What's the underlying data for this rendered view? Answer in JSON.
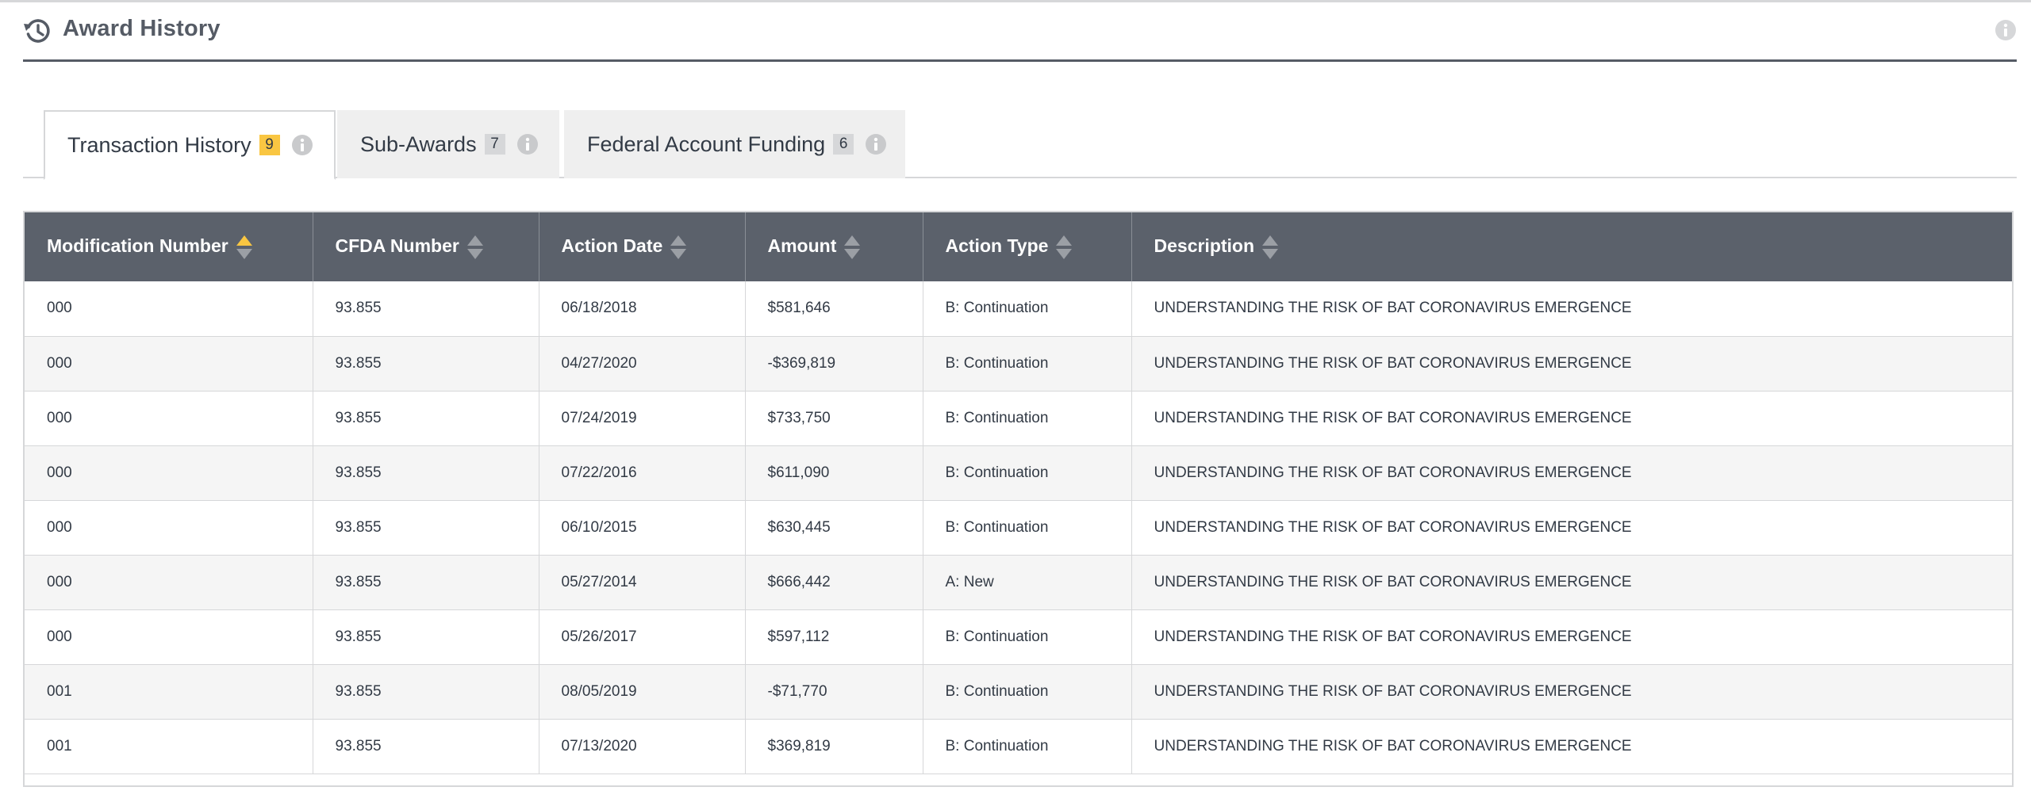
{
  "header": {
    "title": "Award History",
    "icon": "history-icon",
    "info_icon": "info-icon"
  },
  "tabs": [
    {
      "label": "Transaction History",
      "count": "9",
      "active": true
    },
    {
      "label": "Sub-Awards",
      "count": "7",
      "active": false
    },
    {
      "label": "Federal Account Funding",
      "count": "6",
      "active": false
    }
  ],
  "colors": {
    "header_bg": "#5b616b",
    "accent": "#f9c642",
    "title": "#555b65"
  },
  "table": {
    "sort": {
      "column": "Modification Number",
      "direction": "ascending"
    },
    "columns": [
      "Modification Number",
      "CFDA Number",
      "Action Date",
      "Amount",
      "Action Type",
      "Description"
    ],
    "rows": [
      [
        "000",
        "93.855",
        "06/18/2018",
        "$581,646",
        "B: Continuation",
        "UNDERSTANDING THE RISK OF BAT CORONAVIRUS EMERGENCE"
      ],
      [
        "000",
        "93.855",
        "04/27/2020",
        "-$369,819",
        "B: Continuation",
        "UNDERSTANDING THE RISK OF BAT CORONAVIRUS EMERGENCE"
      ],
      [
        "000",
        "93.855",
        "07/24/2019",
        "$733,750",
        "B: Continuation",
        "UNDERSTANDING THE RISK OF BAT CORONAVIRUS EMERGENCE"
      ],
      [
        "000",
        "93.855",
        "07/22/2016",
        "$611,090",
        "B: Continuation",
        "UNDERSTANDING THE RISK OF BAT CORONAVIRUS EMERGENCE"
      ],
      [
        "000",
        "93.855",
        "06/10/2015",
        "$630,445",
        "B: Continuation",
        "UNDERSTANDING THE RISK OF BAT CORONAVIRUS EMERGENCE"
      ],
      [
        "000",
        "93.855",
        "05/27/2014",
        "$666,442",
        "A: New",
        "UNDERSTANDING THE RISK OF BAT CORONAVIRUS EMERGENCE"
      ],
      [
        "000",
        "93.855",
        "05/26/2017",
        "$597,112",
        "B: Continuation",
        "UNDERSTANDING THE RISK OF BAT CORONAVIRUS EMERGENCE"
      ],
      [
        "001",
        "93.855",
        "08/05/2019",
        "-$71,770",
        "B: Continuation",
        "UNDERSTANDING THE RISK OF BAT CORONAVIRUS EMERGENCE"
      ],
      [
        "001",
        "93.855",
        "07/13/2020",
        "$369,819",
        "B: Continuation",
        "UNDERSTANDING THE RISK OF BAT CORONAVIRUS EMERGENCE"
      ]
    ]
  }
}
